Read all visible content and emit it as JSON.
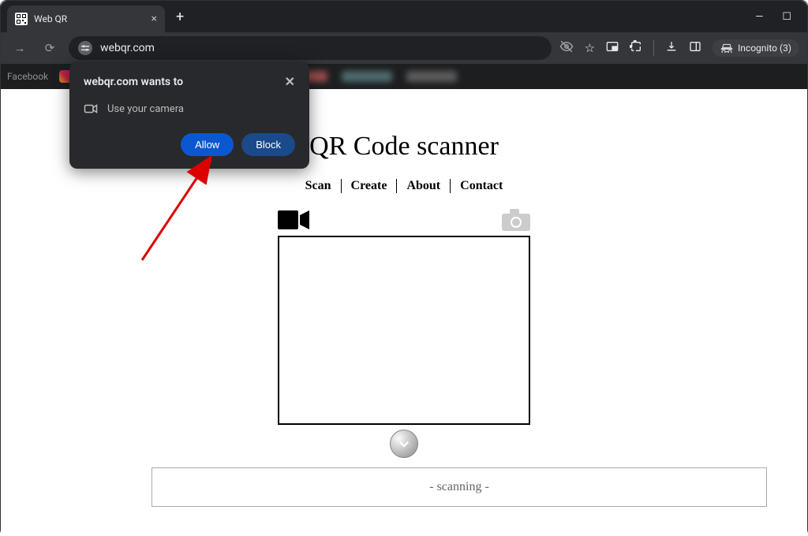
{
  "browser": {
    "tab_title": "Web QR",
    "url": "webqr.com",
    "incognito_label": "Incognito (3)"
  },
  "bookmarks": {
    "facebook": "Facebook"
  },
  "permission": {
    "origin": "webqr.com wants to",
    "item": "Use your camera",
    "allow": "Allow",
    "block": "Block"
  },
  "page": {
    "title": "QR Code scanner",
    "nav": {
      "scan": "Scan",
      "create": "Create",
      "about": "About",
      "contact": "Contact"
    },
    "status": "- scanning -"
  }
}
